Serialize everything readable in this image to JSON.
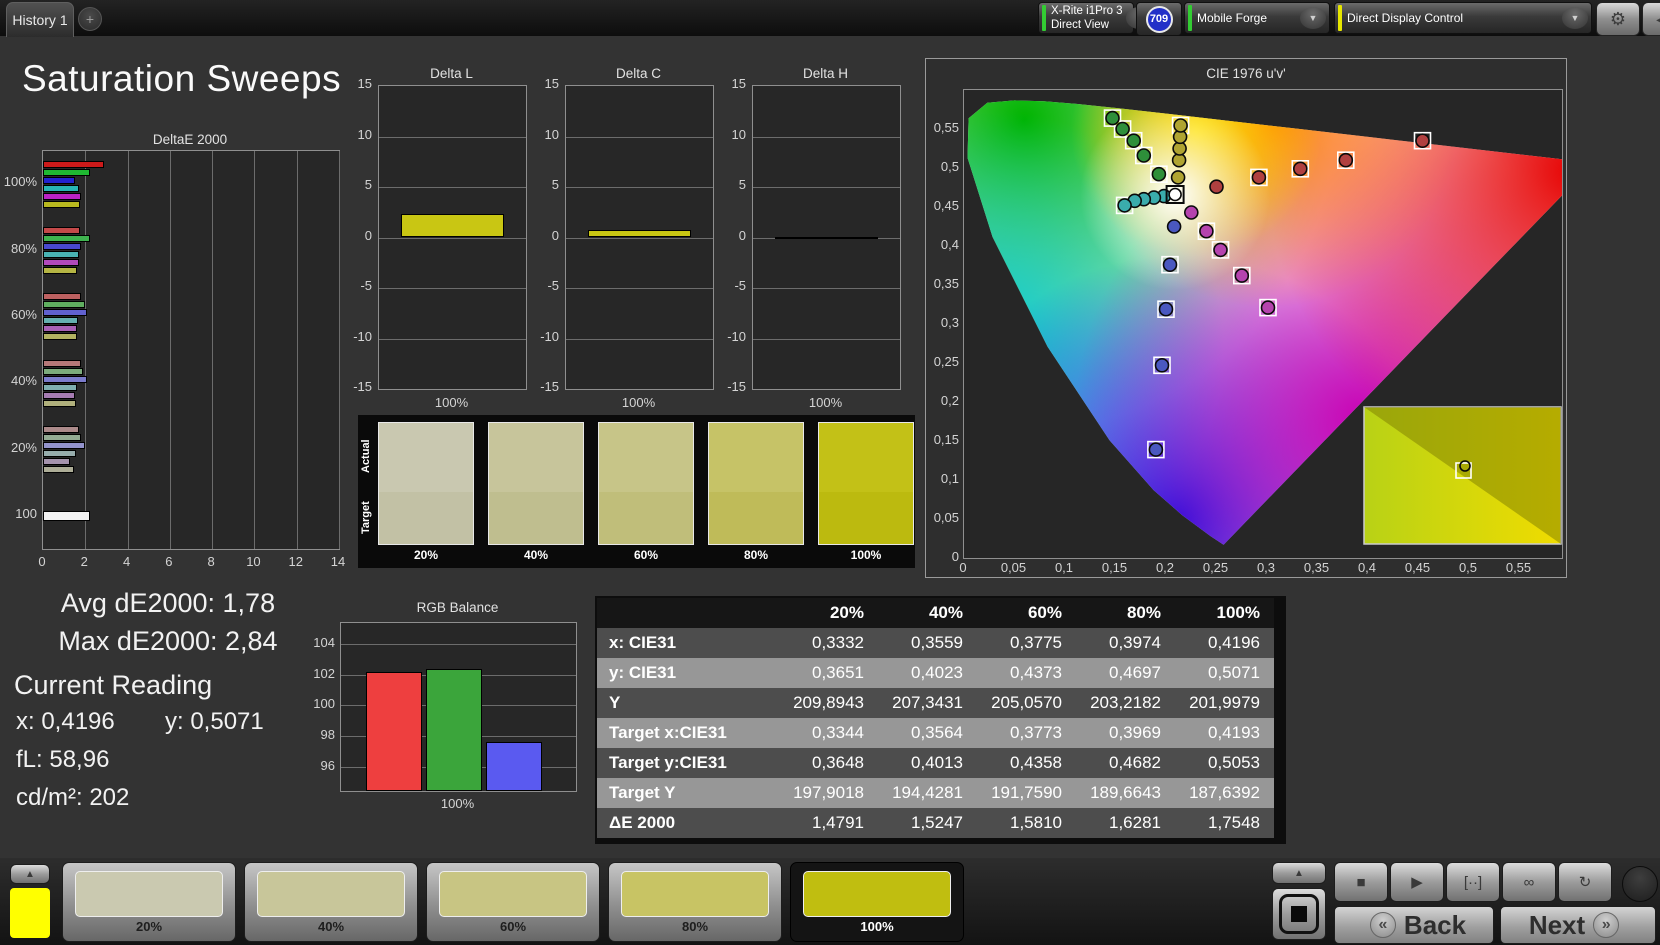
{
  "topbar": {
    "tab_label": "History 1",
    "add_tab_label": "+",
    "meter_dropdown": {
      "line1": "X-Rite i1Pro 3",
      "line2": "Direct View"
    },
    "badge": "709",
    "source_dropdown": "Mobile Forge",
    "workflow_dropdown": "Direct Display Control",
    "gear_icon": "⚙",
    "collapse_icon": "◀",
    "chevron_icon": "▼"
  },
  "page_title": "Saturation Sweeps",
  "colors": {
    "meter_stripe": "#33cc33",
    "source_stripe": "#33cc33",
    "workflow_stripe": "#e6e600",
    "badge_blue": "#2230c8",
    "current_pattern": "#ffff00"
  },
  "chart_data": [
    {
      "type": "bar",
      "id": "deltae2000",
      "title": "DeltaE 2000",
      "orientation": "horizontal",
      "xlim": [
        0,
        14
      ],
      "x_tick_labels": [
        "0",
        "2",
        "4",
        "6",
        "8",
        "10",
        "12",
        "14"
      ],
      "groups": [
        {
          "label": "100%",
          "values": [
            2.9,
            2.2,
            1.5,
            1.7,
            1.8,
            1.75
          ],
          "colors": [
            "#cc1a1a",
            "#1fb832",
            "#2323cf",
            "#27b5b5",
            "#bb22c4",
            "#b8b81f"
          ]
        },
        {
          "label": "80%",
          "values": [
            1.75,
            2.2,
            1.8,
            1.7,
            1.7,
            1.6
          ],
          "colors": [
            "#c44949",
            "#3fb34f",
            "#4848cf",
            "#49b3b3",
            "#b149bb",
            "#b5b544"
          ]
        },
        {
          "label": "60%",
          "values": [
            1.8,
            2.0,
            2.1,
            1.65,
            1.6,
            1.6
          ],
          "colors": [
            "#bd6161",
            "#5fae5f",
            "#6161cf",
            "#65b0b0",
            "#a861b5",
            "#b2b261"
          ]
        },
        {
          "label": "40%",
          "values": [
            1.8,
            1.9,
            2.1,
            1.6,
            1.5,
            1.55
          ],
          "colors": [
            "#b57878",
            "#7cab7c",
            "#7c7ccc",
            "#7fafaf",
            "#a67cb2",
            "#b0b07c"
          ]
        },
        {
          "label": "20%",
          "values": [
            1.7,
            1.8,
            2.0,
            1.55,
            1.3,
            1.45
          ],
          "colors": [
            "#ab8a8a",
            "#93ab93",
            "#9393cc",
            "#97adad",
            "#a593ad",
            "#adad97"
          ]
        },
        {
          "label": "100",
          "values": [
            2.2
          ],
          "colors": [
            "#f2f2f2"
          ]
        }
      ]
    },
    {
      "type": "bar",
      "id": "delta_l",
      "title": "Delta L",
      "ylim": [
        -15,
        15
      ],
      "y_ticks": [
        15,
        10,
        5,
        0,
        -5,
        -10,
        -15
      ],
      "y_tick_labels": [
        "15",
        "10",
        "5",
        "0",
        "-5",
        "-10",
        "-15"
      ],
      "categories": [
        "100%"
      ],
      "values": [
        2.3
      ],
      "colors": [
        "#c9c613"
      ]
    },
    {
      "type": "bar",
      "id": "delta_c",
      "title": "Delta C",
      "ylim": [
        -15,
        15
      ],
      "y_ticks": [
        15,
        10,
        5,
        0,
        -5,
        -10,
        -15
      ],
      "y_tick_labels": [
        "15",
        "10",
        "5",
        "0",
        "-5",
        "-10",
        "-15"
      ],
      "categories": [
        "100%"
      ],
      "values": [
        0.7
      ],
      "colors": [
        "#c9c613"
      ]
    },
    {
      "type": "bar",
      "id": "delta_h",
      "title": "Delta H",
      "ylim": [
        -15,
        15
      ],
      "y_ticks": [
        15,
        10,
        5,
        0,
        -5,
        -10,
        -15
      ],
      "y_tick_labels": [
        "15",
        "10",
        "5",
        "0",
        "-5",
        "-10",
        "-15"
      ],
      "categories": [
        "100%"
      ],
      "values": [
        0.05
      ],
      "colors": [
        "#111111"
      ]
    },
    {
      "type": "scatter",
      "id": "cie",
      "title": "CIE 1976 u'v'",
      "xlim": [
        0,
        0.592
      ],
      "ylim": [
        0,
        0.6
      ],
      "x_tick_labels": [
        "0",
        "0,05",
        "0,1",
        "0,15",
        "0,2",
        "0,25",
        "0,3",
        "0,35",
        "0,4",
        "0,45",
        "0,5",
        "0,55"
      ],
      "y_tick_labels": [
        "0,55",
        "0,5",
        "0,45",
        "0,4",
        "0,35",
        "0,3",
        "0,25",
        "0,2",
        "0,15",
        "0,1",
        "0,05",
        "0"
      ],
      "white_point": [
        0.209,
        0.466
      ],
      "series": [
        {
          "name": "green",
          "color": "#2e8f3a",
          "points": [
            [
              0.193,
              0.492
            ],
            [
              0.178,
              0.516
            ],
            [
              0.168,
              0.535
            ],
            [
              0.157,
              0.55
            ],
            [
              0.147,
              0.564
            ]
          ],
          "target_indices": [
            0,
            1,
            2,
            3,
            4
          ]
        },
        {
          "name": "yellow",
          "color": "#b0a431",
          "points": [
            [
              0.212,
              0.488
            ],
            [
              0.213,
              0.51
            ],
            [
              0.2135,
              0.525
            ],
            [
              0.214,
              0.54
            ],
            [
              0.2145,
              0.5545
            ]
          ],
          "target_indices": [
            4
          ]
        },
        {
          "name": "red",
          "color": "#b04040",
          "points": [
            [
              0.25,
              0.476
            ],
            [
              0.292,
              0.488
            ],
            [
              0.333,
              0.499
            ],
            [
              0.378,
              0.51
            ],
            [
              0.454,
              0.535
            ]
          ],
          "target_indices": [
            1,
            2,
            3,
            4
          ]
        },
        {
          "name": "magenta",
          "color": "#b543ae",
          "points": [
            [
              0.225,
              0.443
            ],
            [
              0.24,
              0.419
            ],
            [
              0.254,
              0.395
            ],
            [
              0.275,
              0.362
            ],
            [
              0.301,
              0.321
            ]
          ],
          "target_indices": [
            1,
            2,
            3,
            4
          ]
        },
        {
          "name": "blue",
          "color": "#4a58c0",
          "points": [
            [
              0.208,
              0.425
            ],
            [
              0.204,
              0.376
            ],
            [
              0.2,
              0.319
            ],
            [
              0.196,
              0.247
            ],
            [
              0.19,
              0.139
            ]
          ],
          "target_indices": [
            1,
            2,
            3,
            4
          ]
        },
        {
          "name": "cyan",
          "color": "#3aacac",
          "points": [
            [
              0.198,
              0.464
            ],
            [
              0.188,
              0.462
            ],
            [
              0.178,
              0.46
            ],
            [
              0.169,
              0.458
            ],
            [
              0.159,
              0.452
            ]
          ],
          "target_indices": [
            4
          ]
        }
      ],
      "inset_zoom": true
    },
    {
      "type": "bar",
      "id": "rgb_balance",
      "title": "RGB Balance",
      "ylim": [
        94.4,
        105.4
      ],
      "y_ticks": [
        104,
        102,
        100,
        98,
        96
      ],
      "y_tick_labels": [
        "104",
        "102",
        "100",
        "98",
        "96"
      ],
      "categories": [
        "Red",
        "Green",
        "Blue"
      ],
      "values": [
        102.2,
        102.4,
        97.6
      ],
      "colors": [
        "#ee3f3f",
        "#3ba53b",
        "#5a5af0"
      ],
      "xlabel": "100%"
    }
  ],
  "swatch_strip": {
    "row_labels": [
      "Actual",
      "Target"
    ],
    "items": [
      {
        "label": "20%",
        "actual": "#c9c8b0",
        "target": "#c2c1a5"
      },
      {
        "label": "40%",
        "actual": "#c7c59b",
        "target": "#bfbe8f"
      },
      {
        "label": "60%",
        "actual": "#c7c588",
        "target": "#c0be7a"
      },
      {
        "label": "80%",
        "actual": "#c6c367",
        "target": "#bfbb59"
      },
      {
        "label": "100%",
        "actual": "#c3c117",
        "target": "#bcba0f"
      }
    ]
  },
  "stats": {
    "avg": "Avg dE2000: 1,78",
    "max": "Max dE2000: 2,84"
  },
  "reading": {
    "title": "Current Reading",
    "x": "x: 0,4196",
    "y": "y: 0,5071",
    "fl": "fL: 58,96",
    "luminance": "cd/m²: 202"
  },
  "table": {
    "corner": "",
    "col_headers": [
      "20%",
      "40%",
      "60%",
      "80%",
      "100%"
    ],
    "rows": [
      {
        "label": "x: CIE31",
        "values": [
          "0,3332",
          "0,3559",
          "0,3775",
          "0,3974",
          "0,4196"
        ]
      },
      {
        "label": "y: CIE31",
        "values": [
          "0,3651",
          "0,4023",
          "0,4373",
          "0,4697",
          "0,5071"
        ]
      },
      {
        "label": "Y",
        "values": [
          "209,8943",
          "207,3431",
          "205,0570",
          "203,2182",
          "201,9979"
        ]
      },
      {
        "label": "Target x:CIE31",
        "values": [
          "0,3344",
          "0,3564",
          "0,3773",
          "0,3969",
          "0,4193"
        ]
      },
      {
        "label": "Target y:CIE31",
        "values": [
          "0,3648",
          "0,4013",
          "0,4358",
          "0,4682",
          "0,5053"
        ]
      },
      {
        "label": "Target Y",
        "values": [
          "197,9018",
          "194,4281",
          "191,7590",
          "189,6643",
          "187,6392"
        ]
      },
      {
        "label": "ΔE 2000",
        "values": [
          "1,4791",
          "1,5247",
          "1,5810",
          "1,6281",
          "1,7548"
        ]
      }
    ]
  },
  "bottom_bar": {
    "up_icon": "▲",
    "patterns": [
      {
        "label": "20%",
        "color": "#cac9b0",
        "selected": false
      },
      {
        "label": "40%",
        "color": "#c8c69a",
        "selected": false
      },
      {
        "label": "60%",
        "color": "#c8c583",
        "selected": false
      },
      {
        "label": "80%",
        "color": "#c8c464",
        "selected": false
      },
      {
        "label": "100%",
        "color": "#c0be10",
        "selected": true
      }
    ],
    "transport": [
      {
        "name": "stop",
        "glyph": "■"
      },
      {
        "name": "play",
        "glyph": "▶"
      },
      {
        "name": "range",
        "glyph": "[··]"
      },
      {
        "name": "continuous",
        "glyph": "∞"
      },
      {
        "name": "refresh",
        "glyph": "↻"
      }
    ],
    "back_label": "Back",
    "next_label": "Next",
    "back_icon": "«",
    "next_icon": "»"
  }
}
